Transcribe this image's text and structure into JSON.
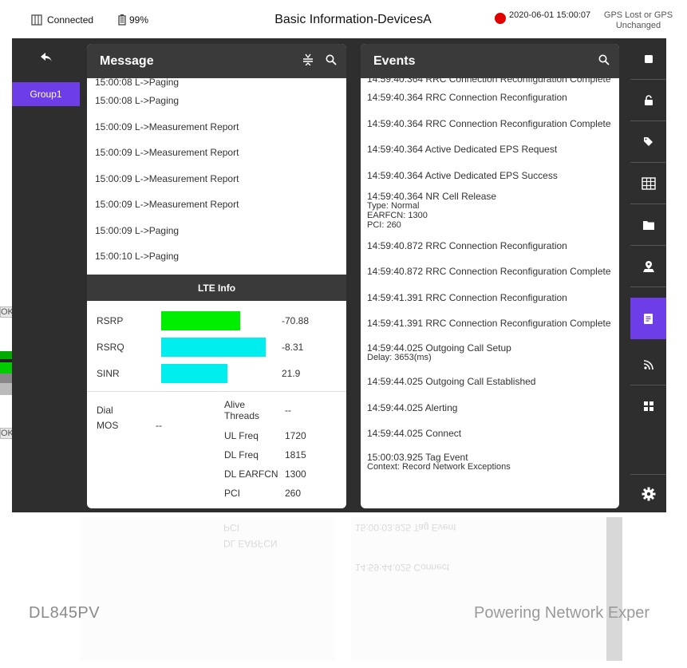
{
  "status": {
    "connection": "Connected",
    "battery": "99%",
    "title": "Basic Information-DevicesA",
    "datetime": "2020-06-01  15:00:07",
    "gps_line1": "GPS Lost or GPS",
    "gps_line2": "Unchanged",
    "record_color": "#e00000"
  },
  "left_nav": {
    "back_icon": "back-arrow-icon",
    "group": "Group1",
    "accent": "#6d3ee8"
  },
  "message_panel": {
    "title": "Message",
    "top_cut": "15:00:08  L->Paging",
    "items": [
      "15:00:08  L->Paging",
      "15:00:09  L->Measurement Report",
      "15:00:09  L->Measurement Report",
      "15:00:09  L->Measurement Report",
      "15:00:09  L->Measurement Report",
      "15:00:09  L->Paging",
      "15:00:10  L->Paging"
    ]
  },
  "lte_info": {
    "title": "LTE Info",
    "metrics": [
      {
        "label": "RSRP",
        "value": "-70.88",
        "color": "#00ee00",
        "fill": 0.66
      },
      {
        "label": "RSRQ",
        "value": "-8.31",
        "color": "#00eeee",
        "fill": 0.87
      },
      {
        "label": "SINR",
        "value": "21.9",
        "color": "#00eeee",
        "fill": 0.55
      }
    ],
    "dial_label": "Dial",
    "mos_label": "MOS",
    "mos_value": "--",
    "alive_label_1": "Alive",
    "alive_label_2": "Threads",
    "alive_value": "--",
    "ul_freq_label": "UL Freq",
    "ul_freq_value": "1720",
    "dl_freq_label": "DL Freq",
    "dl_freq_value": "1815",
    "dl_earfcn_label": "DL EARFCN",
    "dl_earfcn_value": "1300",
    "pci_label": "PCI",
    "pci_value": "260"
  },
  "events_panel": {
    "title": "Events",
    "top_cut": "14:59:40.364  RRC Connection Reconfiguration Complete",
    "items": [
      {
        "text": "14:59:40.364  RRC Connection Reconfiguration"
      },
      {
        "text": "14:59:40.364  RRC Connection Reconfiguration Complete"
      },
      {
        "text": "14:59:40.364  Active Dedicated EPS Request"
      },
      {
        "text": "14:59:40.364  Active Dedicated EPS Success"
      },
      {
        "text": "14:59:40.364  NR Cell Release",
        "lines": [
          "Type: Normal",
          "EARFCN: 1300",
          "PCI: 260"
        ]
      },
      {
        "text": "14:59:40.872  RRC Connection Reconfiguration"
      },
      {
        "text": "14:59:40.872  RRC Connection Reconfiguration Complete"
      },
      {
        "text": "14:59:41.391  RRC Connection Reconfiguration"
      },
      {
        "text": "14:59:41.391  RRC Connection Reconfiguration Complete"
      },
      {
        "text": "14:59:44.025  Outgoing Call Setup",
        "lines": [
          "Delay: 3653(ms)"
        ]
      },
      {
        "text": "14:59:44.025  Outgoing Call Established"
      },
      {
        "text": "14:59:44.025  Alerting"
      },
      {
        "text": "14:59:44.025  Connect"
      },
      {
        "text": "15:00:03.925  Tag Event",
        "lines": [
          "Context:  Record Network Exceptions"
        ]
      }
    ]
  },
  "right_nav": {
    "icons": [
      "stop-icon",
      "unlock-icon",
      "tag-icon",
      "table-icon",
      "folder-icon",
      "map-pin-icon",
      "document-icon",
      "rss-icon",
      "grid-icon",
      "settings-icon"
    ],
    "active_index": 6
  },
  "edge": {
    "ok_1": "OK",
    "ok_2": "OK"
  },
  "branding": {
    "model": "DL845PV",
    "tagline": "Powering Network Exper"
  }
}
